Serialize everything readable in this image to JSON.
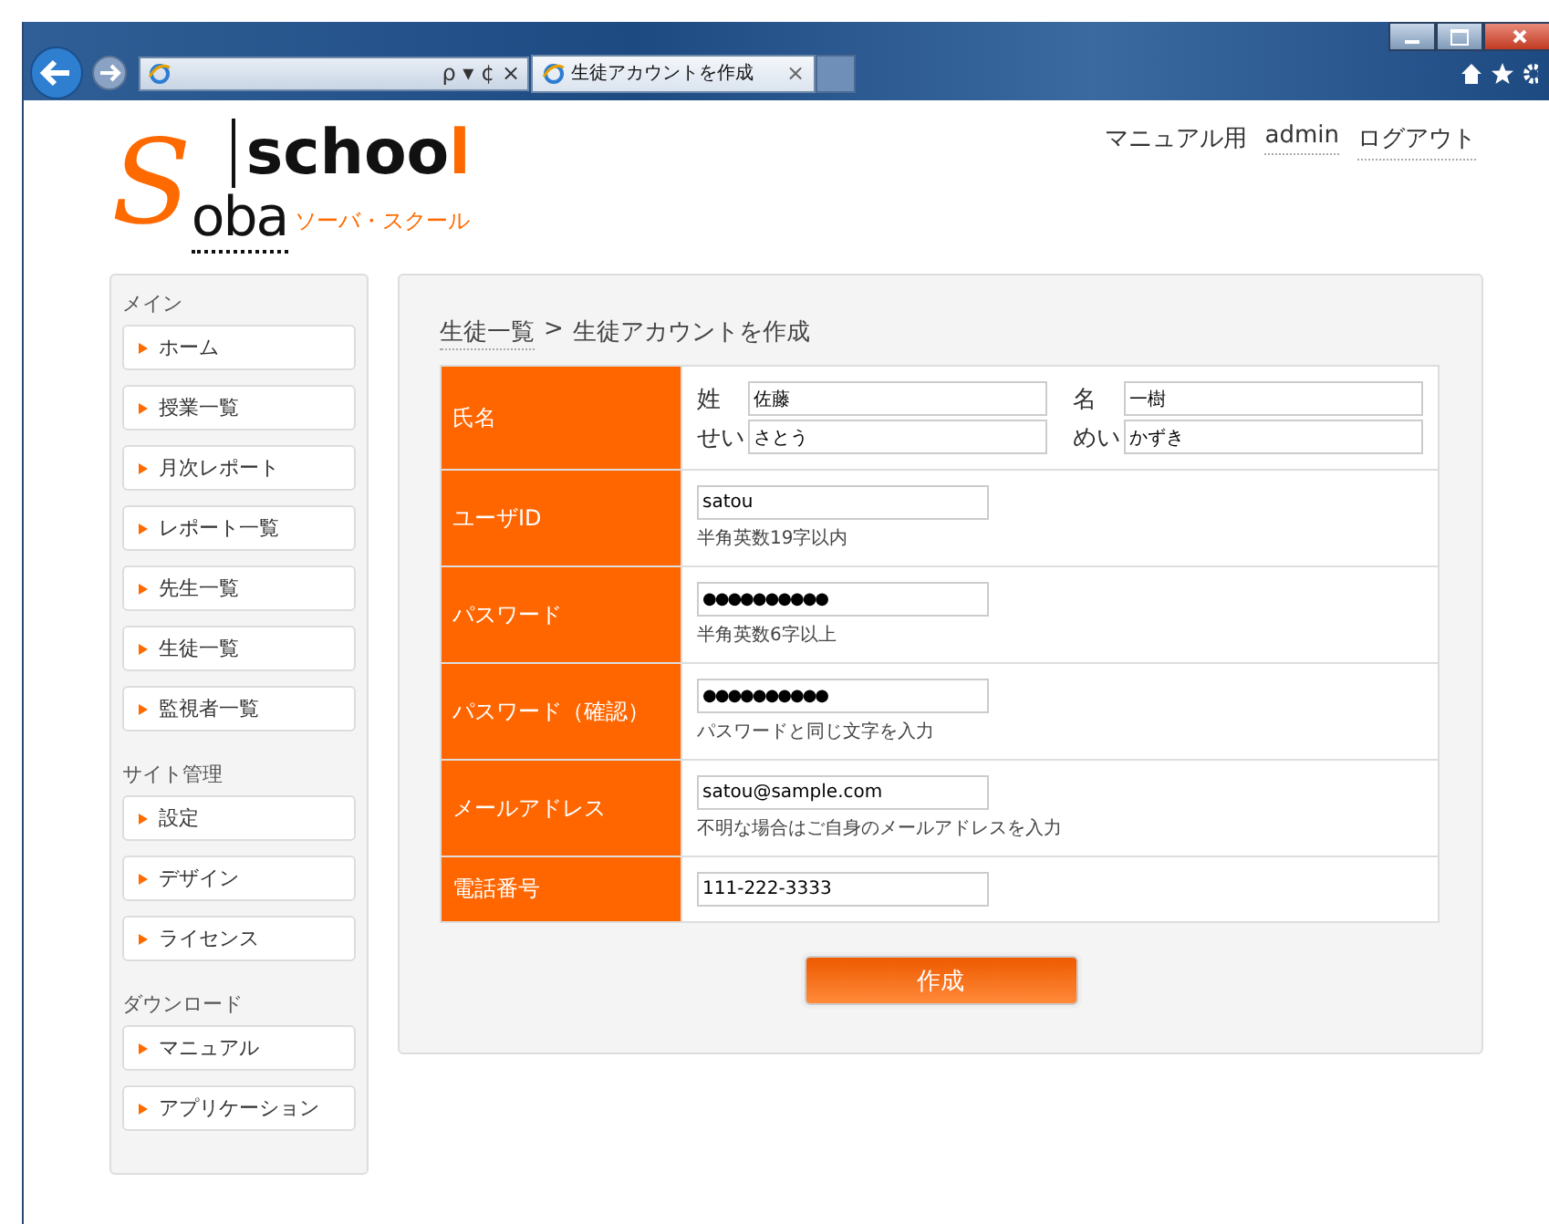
{
  "browser": {
    "tab_title": "生徒アカウントを作成",
    "tab_close": "×",
    "address_tools": "ρ ▾ ¢ ×"
  },
  "logo": {
    "initial": "S",
    "word": "oba",
    "school": "schoo",
    "school_end": "l",
    "tagline": "ソーバ・スクール"
  },
  "header_links": [
    {
      "label": "マニュアル用",
      "link": false
    },
    {
      "label": "admin",
      "link": true
    },
    {
      "label": "ログアウト",
      "link": true
    }
  ],
  "sidebar": [
    {
      "title": "メイン",
      "items": [
        "ホーム",
        "授業一覧",
        "月次レポート",
        "レポート一覧",
        "先生一覧",
        "生徒一覧",
        "監視者一覧"
      ]
    },
    {
      "title": "サイト管理",
      "items": [
        "設定",
        "デザイン",
        "ライセンス"
      ]
    },
    {
      "title": "ダウンロード",
      "items": [
        "マニュアル",
        "アプリケーション"
      ]
    }
  ],
  "breadcrumb": {
    "parent": "生徒一覧",
    "separator": ">",
    "current": "生徒アカウントを作成"
  },
  "form": [
    {
      "kind": "name",
      "label": "氏名",
      "fields": [
        {
          "label": "姓",
          "value": "佐藤"
        },
        {
          "label": "名",
          "value": "一樹"
        },
        {
          "label": "せい",
          "value": "さとう"
        },
        {
          "label": "めい",
          "value": "かずき"
        }
      ]
    },
    {
      "kind": "text",
      "label": "ユーザID",
      "value": "satou",
      "hint": "半角英数19字以内"
    },
    {
      "kind": "password",
      "label": "パスワード",
      "value": "●●●●●●●●●●",
      "hint": "半角英数6字以上"
    },
    {
      "kind": "password",
      "label": "パスワード（確認）",
      "value": "●●●●●●●●●●",
      "hint": "パスワードと同じ文字を入力"
    },
    {
      "kind": "text",
      "label": "メールアドレス",
      "value": "satou@sample.com",
      "hint": "不明な場合はご自身のメールアドレスを入力"
    },
    {
      "kind": "text",
      "label": "電話番号",
      "value": "111-222-3333"
    }
  ],
  "submit": "作成"
}
